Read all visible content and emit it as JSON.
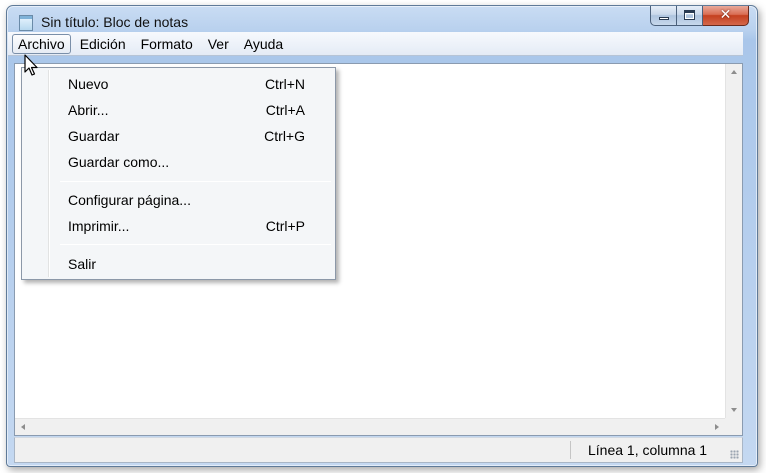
{
  "window": {
    "title": "Sin título: Bloc de notas",
    "minimize_icon": "minimize-icon",
    "maximize_icon": "maximize-icon",
    "close_icon": "close-icon",
    "close_glyph": "✕"
  },
  "menubar": {
    "items": [
      {
        "label": "Archivo",
        "active": true
      },
      {
        "label": "Edición"
      },
      {
        "label": "Formato"
      },
      {
        "label": "Ver"
      },
      {
        "label": "Ayuda"
      }
    ]
  },
  "file_menu": {
    "items": [
      {
        "label": "Nuevo",
        "shortcut": "Ctrl+N"
      },
      {
        "label": "Abrir...",
        "shortcut": "Ctrl+A"
      },
      {
        "label": "Guardar",
        "shortcut": "Ctrl+G"
      },
      {
        "label": "Guardar como...",
        "shortcut": ""
      },
      {
        "label": "Configurar página...",
        "shortcut": ""
      },
      {
        "label": "Imprimir...",
        "shortcut": "Ctrl+P"
      },
      {
        "label": "Salir",
        "shortcut": ""
      }
    ]
  },
  "editor": {
    "content": ""
  },
  "statusbar": {
    "position": "Línea 1, columna 1"
  },
  "colors": {
    "frame": "#b9d1ee",
    "close_button": "#c4401f",
    "menu_background": "#f4f6f8"
  }
}
